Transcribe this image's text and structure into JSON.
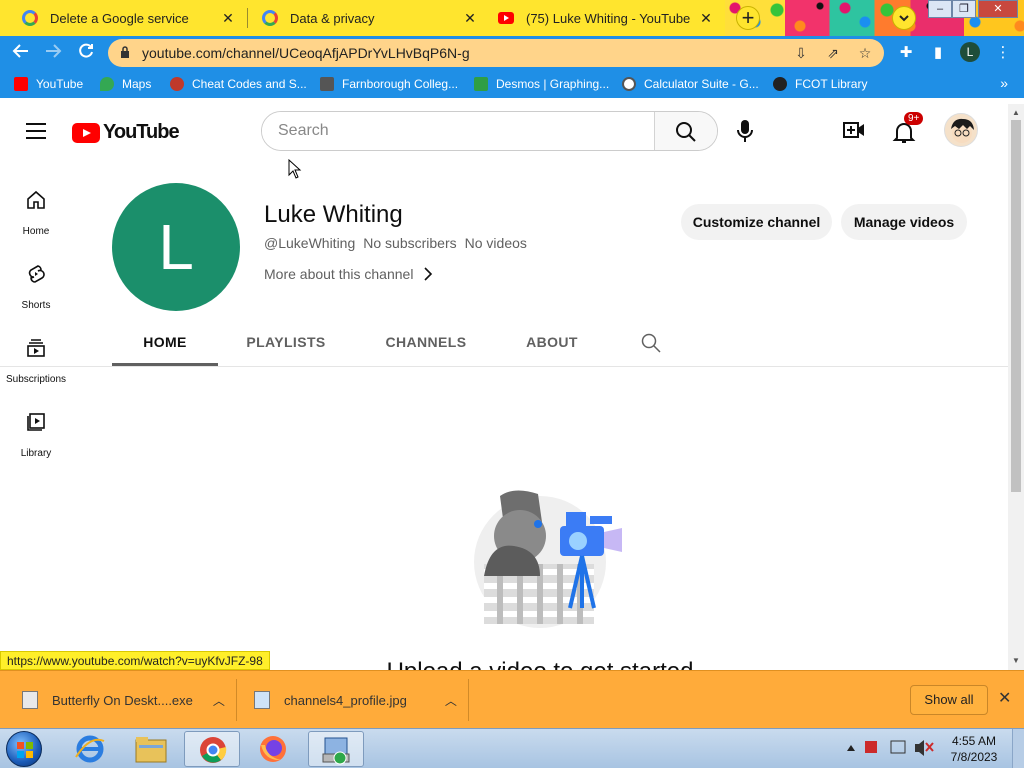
{
  "browser": {
    "tabs": [
      {
        "title": "Delete a Google service",
        "icon": "google-icon"
      },
      {
        "title": "Data & privacy",
        "icon": "google-icon"
      },
      {
        "title": "(75) Luke Whiting - YouTube",
        "icon": "youtube-icon"
      }
    ],
    "new_tab_label": "+",
    "url": "youtube.com/channel/UCeoqAfjAPDrYvLHvBqP6N-g",
    "profile_letter": "L",
    "bookmarks": [
      {
        "label": "YouTube",
        "color": "#ff0000"
      },
      {
        "label": "Maps",
        "color": "#34a853"
      },
      {
        "label": "Cheat Codes and S...",
        "color": "#c0392b"
      },
      {
        "label": "Farnborough Colleg...",
        "color": "#555555"
      },
      {
        "label": "Desmos | Graphing...",
        "color": "#2f9e44"
      },
      {
        "label": "Calculator Suite - G...",
        "color": "#666666"
      },
      {
        "label": "FCOT Library",
        "color": "#222222"
      }
    ]
  },
  "youtube": {
    "logo_text": "YouTube",
    "search_placeholder": "Search",
    "notification_count": "9+",
    "rail": [
      {
        "label": "Home",
        "icon": "home-icon"
      },
      {
        "label": "Shorts",
        "icon": "shorts-icon"
      },
      {
        "label": "Subscriptions",
        "icon": "subscriptions-icon"
      },
      {
        "label": "Library",
        "icon": "library-icon"
      }
    ],
    "channel": {
      "avatar_letter": "L",
      "avatar_color": "#1b8f6b",
      "name": "Luke Whiting",
      "handle": "@LukeWhiting",
      "subscribers": "No subscribers",
      "videos": "No videos",
      "more_about": "More about this channel",
      "customize_label": "Customize channel",
      "manage_label": "Manage videos"
    },
    "tabs": [
      "HOME",
      "PLAYLISTS",
      "CHANNELS",
      "ABOUT"
    ],
    "active_tab": "HOME",
    "empty_state_text": "Upload a video to get started"
  },
  "status_url": "https://www.youtube.com/watch?v=uyKfvJFZ-98",
  "downloads": {
    "items": [
      {
        "name": "Butterfly On Deskt....exe"
      },
      {
        "name": "channels4_profile.jpg"
      }
    ],
    "show_all_label": "Show all"
  },
  "taskbar": {
    "time": "4:55 AM",
    "date": "7/8/2023"
  }
}
